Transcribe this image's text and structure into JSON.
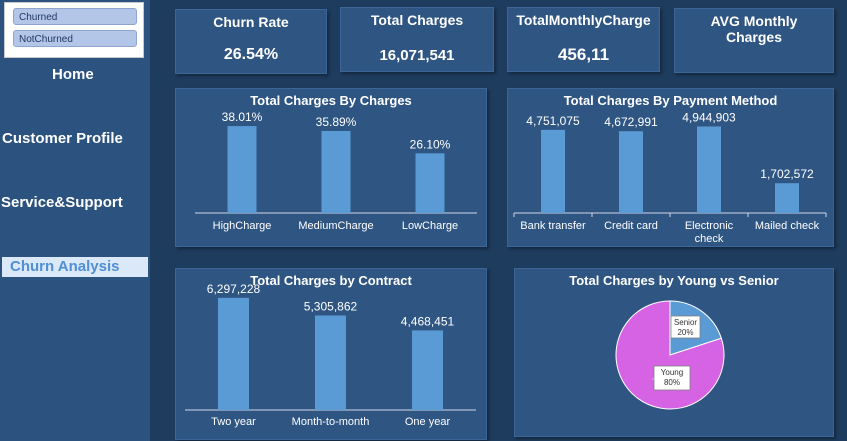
{
  "slicer": {
    "items": [
      "Churned",
      "NotChurned"
    ]
  },
  "nav": {
    "home": "Home",
    "customer_profile": "Customer Profile",
    "service_support": "Service&Support",
    "churn_analysis": "Churn Analysis"
  },
  "kpis": {
    "churn_rate": {
      "title": "Churn Rate",
      "value": "26.54%"
    },
    "total_charges": {
      "title": "Total Charges",
      "value": "16,071,541"
    },
    "total_monthly_charge": {
      "title": "TotalMonthlyCharge",
      "value": "456,11"
    },
    "avg_monthly_charges": {
      "title_line1": "AVG Monthly",
      "title_line2": "Charges"
    }
  },
  "chart_data": [
    {
      "id": "by_charges",
      "type": "bar",
      "title": "Total Charges By Charges",
      "categories": [
        "HighCharge",
        "MediumCharge",
        "LowCharge"
      ],
      "values": [
        38.01,
        35.89,
        26.1
      ],
      "labels": [
        "38.01%",
        "35.89%",
        "26.10%"
      ],
      "ylim": [
        0,
        42
      ]
    },
    {
      "id": "by_payment",
      "type": "bar",
      "title": "Total Charges  By Payment Method",
      "categories": [
        "Bank transfer",
        "Credit card",
        "Electronic check",
        "Mailed check"
      ],
      "values": [
        4751075,
        4672991,
        4944903,
        1702572
      ],
      "labels": [
        "4,751,075",
        "4,672,991",
        "4,944,903",
        "1,702,572"
      ],
      "ylim": [
        0,
        5600000
      ]
    },
    {
      "id": "by_contract",
      "type": "bar",
      "title": "Total Charges by Contract",
      "categories": [
        "Two year",
        "Month-to-month",
        "One year"
      ],
      "values": [
        6297228,
        5305862,
        4468451
      ],
      "labels": [
        "6,297,228",
        "5,305,862",
        "4,468,451"
      ],
      "ylim": [
        0,
        6400000
      ]
    },
    {
      "id": "young_senior",
      "type": "pie",
      "title": "Total Charges by Young vs Senior",
      "slices": [
        {
          "name": "Senior",
          "value": 20,
          "label": "20%",
          "color": "#5b9bd5"
        },
        {
          "name": "Young",
          "value": 80,
          "label": "80%",
          "color": "#d563e3"
        }
      ]
    }
  ]
}
